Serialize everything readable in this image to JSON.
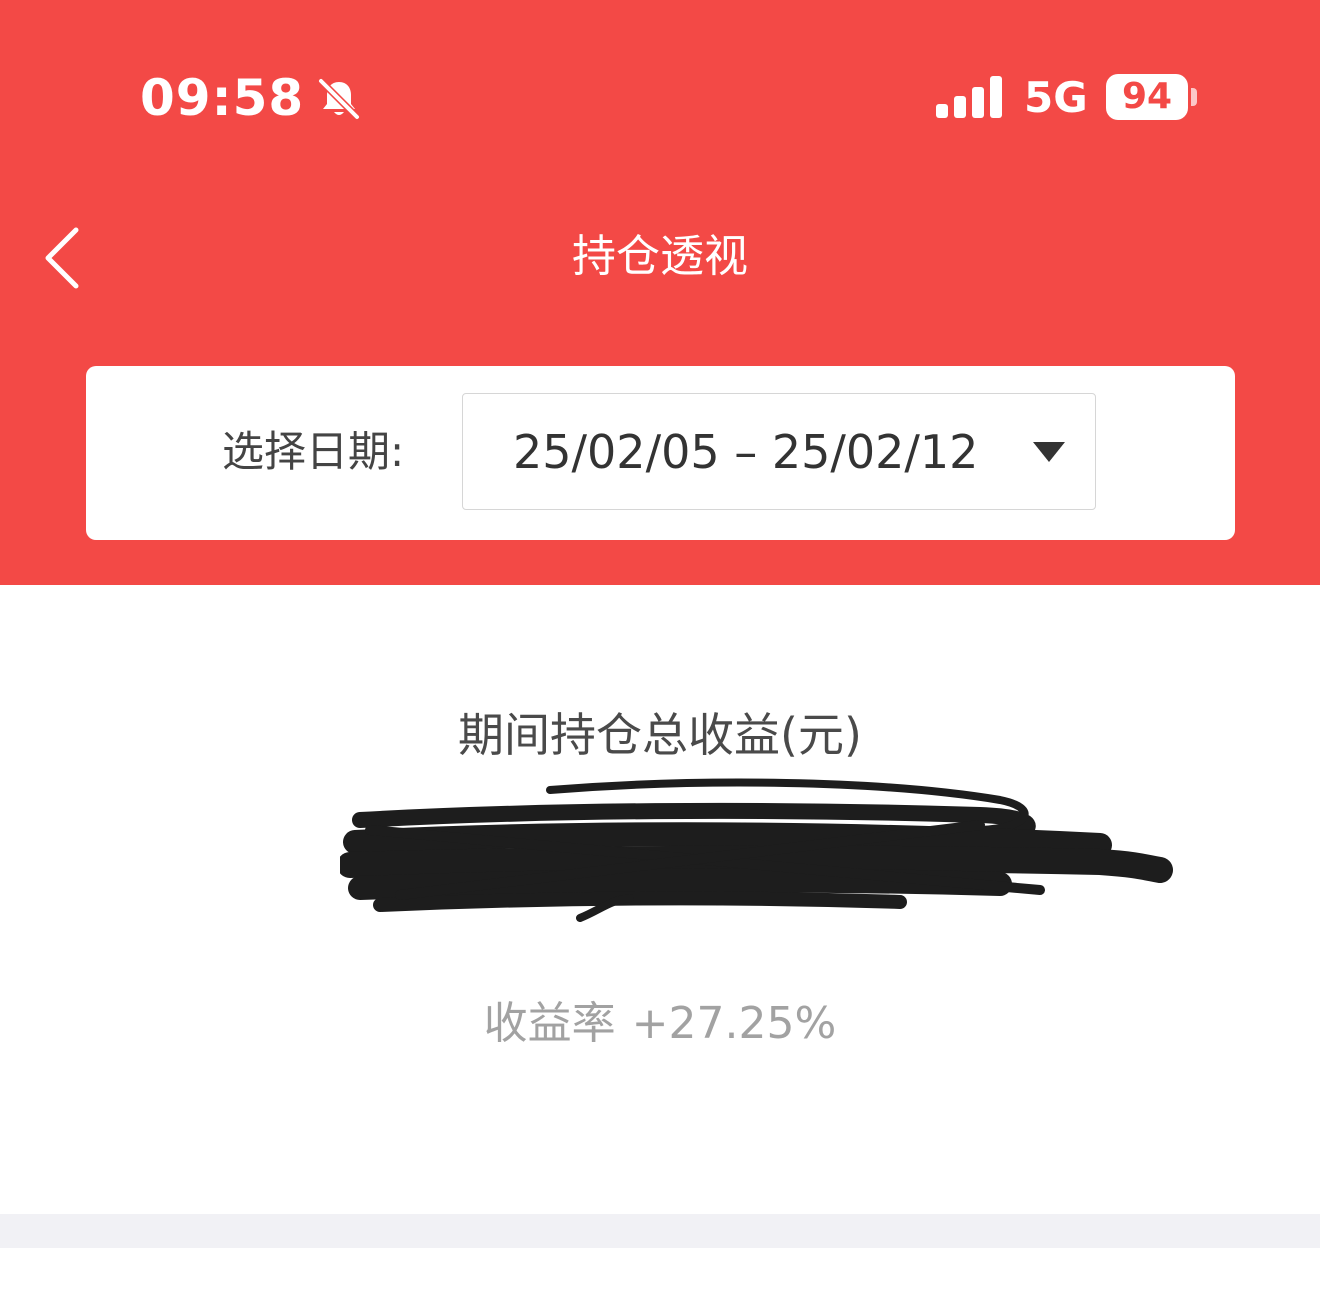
{
  "status_bar": {
    "time": "09:58",
    "network": "5G",
    "battery": "94",
    "icons": [
      "bell-slash-icon",
      "signal-icon",
      "battery-icon"
    ]
  },
  "nav": {
    "title": "持仓透视",
    "back_icon": "chevron-left-icon"
  },
  "date_filter": {
    "label": "选择日期:",
    "value": "25/02/05 – 25/02/12",
    "dropdown_icon": "caret-down-icon"
  },
  "summary": {
    "title": "期间持仓总收益(元)",
    "rate_label": "收益率",
    "rate_value": "+27.25%"
  },
  "colors": {
    "header_bg": "#f34946",
    "card_bg": "#ffffff",
    "divider": "#f1f1f5"
  }
}
